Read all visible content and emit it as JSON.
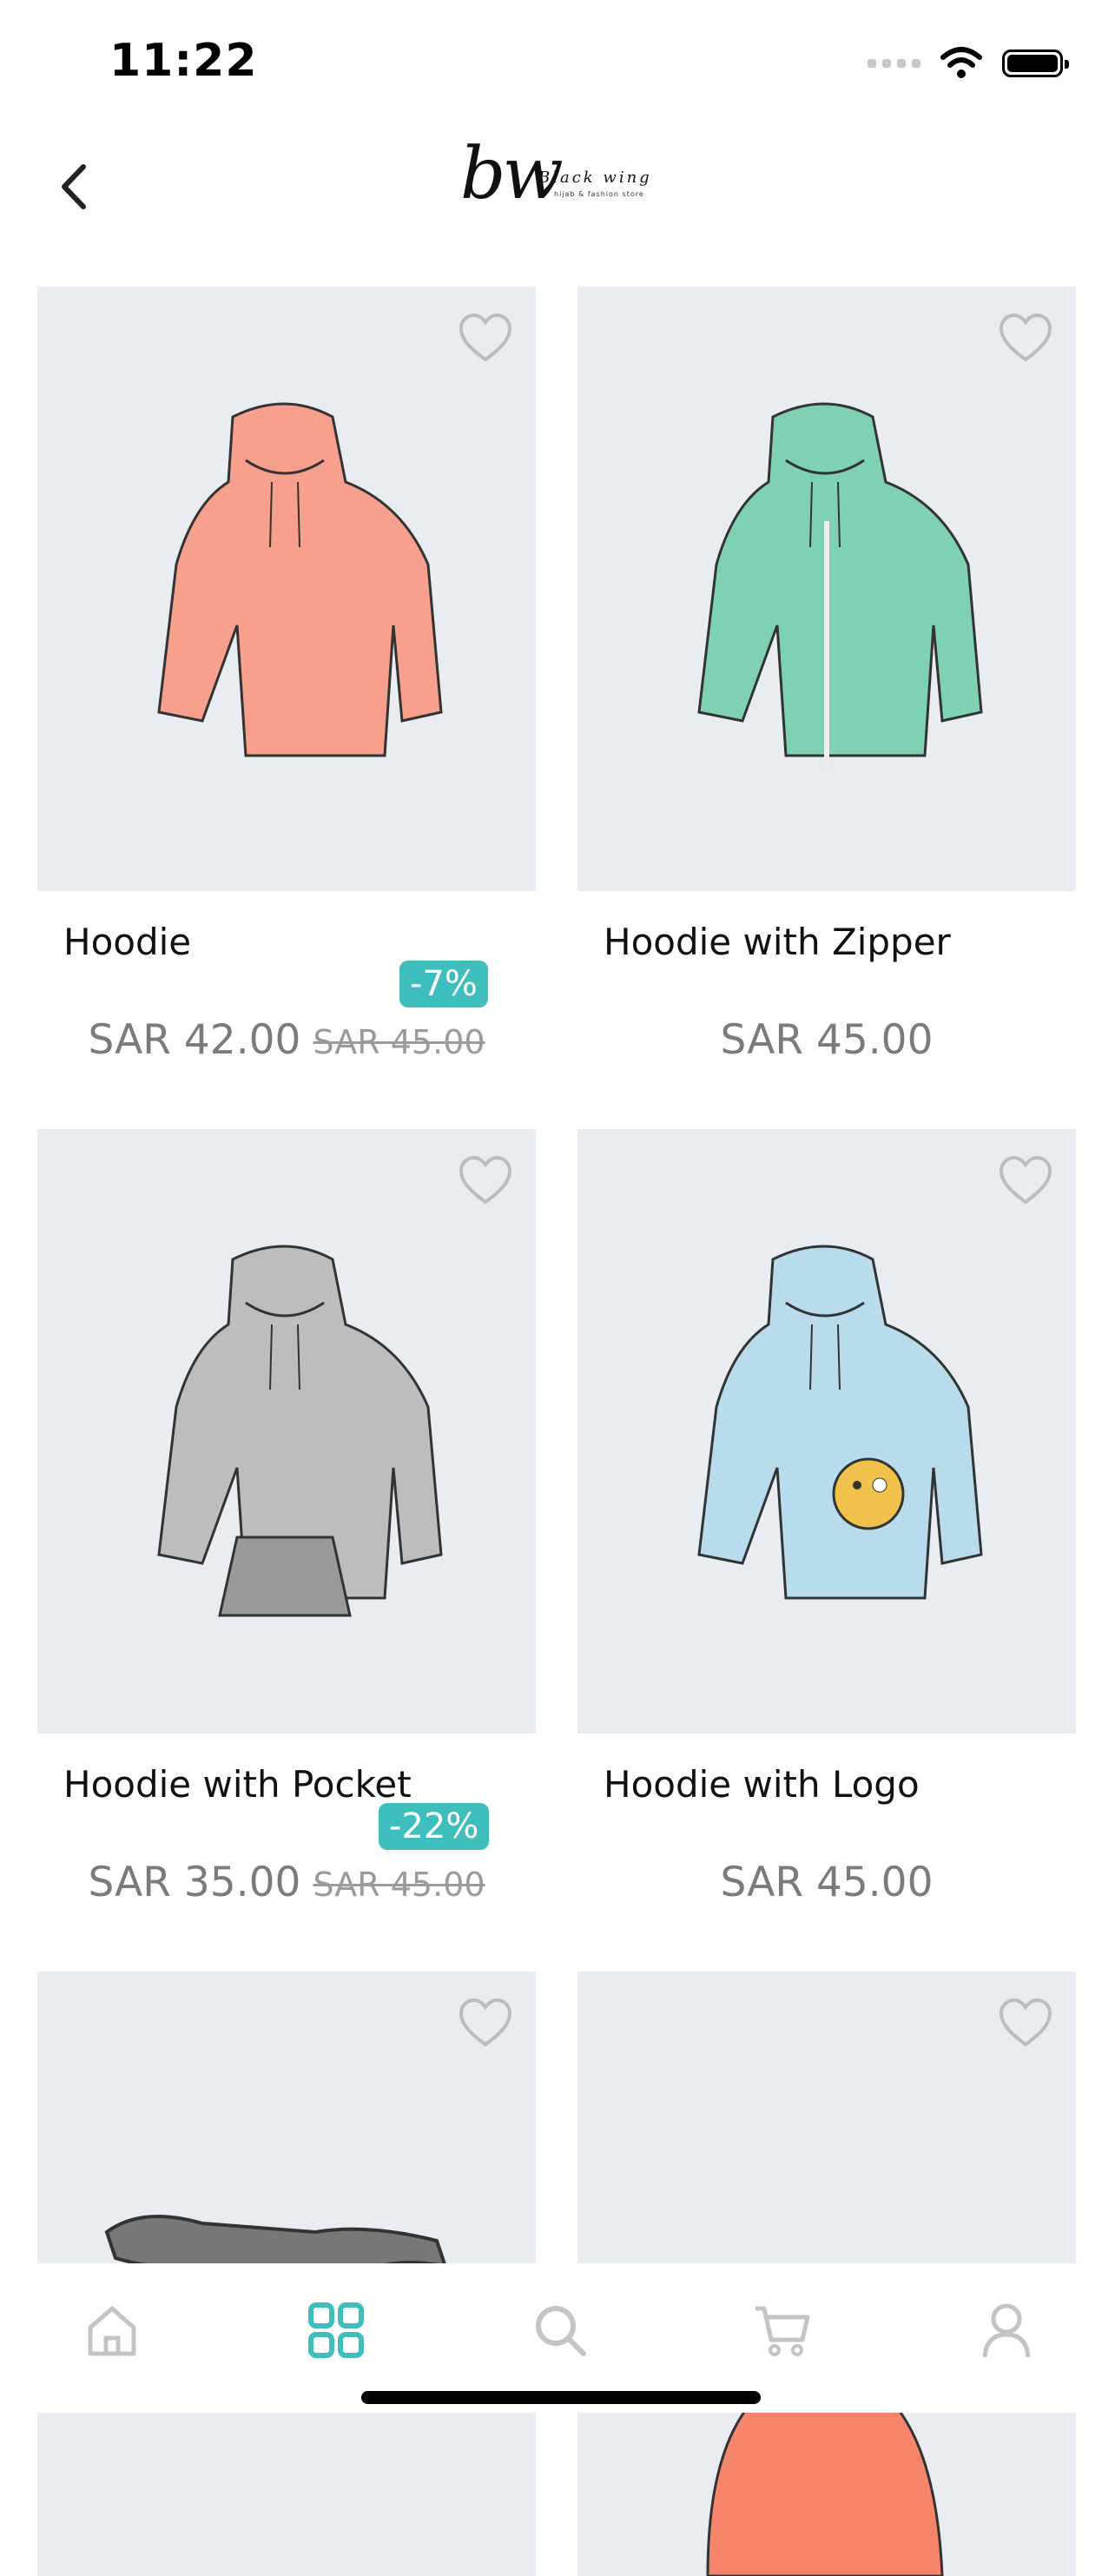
{
  "status": {
    "time": "11:22"
  },
  "brand": {
    "mark": "bw",
    "name": "Black wing",
    "tagline": "hijab & fashion store"
  },
  "products": [
    {
      "title": "Hoodie",
      "price": "SAR 42.00",
      "old_price": "SAR 45.00",
      "badge": "-7%",
      "color": "#f7a08d"
    },
    {
      "title": "Hoodie with Zipper",
      "price": "SAR 45.00",
      "old_price": "",
      "badge": "",
      "color": "#7fd1b3"
    },
    {
      "title": "Hoodie with Pocket",
      "price": "SAR 35.00",
      "old_price": "SAR 45.00",
      "badge": "-22%",
      "color": "#bdbdbd"
    },
    {
      "title": "Hoodie with Logo",
      "price": "SAR 45.00",
      "old_price": "",
      "badge": "",
      "color": "#b9dcec"
    },
    {
      "title": "",
      "price": "",
      "old_price": "",
      "badge": "",
      "color": "#777777"
    },
    {
      "title": "",
      "price": "",
      "old_price": "",
      "badge": "",
      "color": "#f7856c"
    }
  ],
  "tabs": [
    {
      "icon": "home-icon",
      "active": false
    },
    {
      "icon": "grid-icon",
      "active": true
    },
    {
      "icon": "search-icon",
      "active": false
    },
    {
      "icon": "cart-icon",
      "active": false
    },
    {
      "icon": "profile-icon",
      "active": false
    }
  ],
  "colors": {
    "accent": "#3ebfbe",
    "tile_bg": "#e9edf2",
    "icon_gray": "#c4c4c4"
  }
}
